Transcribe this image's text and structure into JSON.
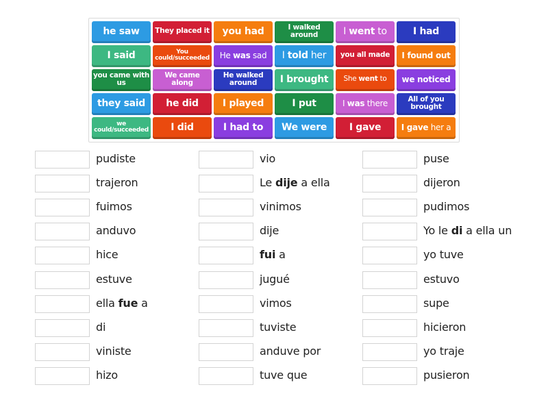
{
  "colors": {
    "blue": "#2d9be3",
    "red": "#d21f35",
    "orange": "#f57d0f",
    "darkgreen": "#1e8e46",
    "pink": "#c85fd2",
    "navy": "#2b3bbf",
    "green": "#3db882",
    "redorange": "#ea4a0e",
    "purple": "#8a3ee0"
  },
  "tiles": [
    [
      {
        "parts": [
          {
            "t": "he saw",
            "b": true
          }
        ],
        "color": "blue",
        "size": "l"
      },
      {
        "parts": [
          {
            "t": "They placed it",
            "b": true
          }
        ],
        "color": "red",
        "size": "s"
      },
      {
        "parts": [
          {
            "t": "you had",
            "b": true
          }
        ],
        "color": "orange",
        "size": "l"
      },
      {
        "parts": [
          {
            "t": "I walked around",
            "b": true
          }
        ],
        "color": "darkgreen",
        "size": "s"
      },
      {
        "parts": [
          {
            "t": "I ",
            "b": false
          },
          {
            "t": "went",
            "b": true
          },
          {
            "t": " to",
            "b": false
          }
        ],
        "color": "pink",
        "size": "l"
      },
      {
        "parts": [
          {
            "t": "I had",
            "b": true
          }
        ],
        "color": "navy",
        "size": "l"
      }
    ],
    [
      {
        "parts": [
          {
            "t": "I said",
            "b": true
          }
        ],
        "color": "green",
        "size": "l"
      },
      {
        "parts": [
          {
            "t": "You could/succeeded",
            "b": true
          }
        ],
        "color": "redorange",
        "size": "xs"
      },
      {
        "parts": [
          {
            "t": "He ",
            "b": false
          },
          {
            "t": "was",
            "b": true
          },
          {
            "t": " sad",
            "b": false
          }
        ],
        "color": "purple",
        "size": "m"
      },
      {
        "parts": [
          {
            "t": "I ",
            "b": false
          },
          {
            "t": "told",
            "b": true
          },
          {
            "t": " her",
            "b": false
          }
        ],
        "color": "blue",
        "size": "l"
      },
      {
        "parts": [
          {
            "t": "you all made",
            "b": true
          }
        ],
        "color": "red",
        "size": "s"
      },
      {
        "parts": [
          {
            "t": "I found out",
            "b": true
          }
        ],
        "color": "orange",
        "size": "m"
      }
    ],
    [
      {
        "parts": [
          {
            "t": "you came with us",
            "b": true
          }
        ],
        "color": "darkgreen",
        "size": "s"
      },
      {
        "parts": [
          {
            "t": "We came along",
            "b": true
          }
        ],
        "color": "pink",
        "size": "s"
      },
      {
        "parts": [
          {
            "t": "He walked around",
            "b": true
          }
        ],
        "color": "navy",
        "size": "s"
      },
      {
        "parts": [
          {
            "t": "I brought",
            "b": true
          }
        ],
        "color": "green",
        "size": "l"
      },
      {
        "parts": [
          {
            "t": "She ",
            "b": false
          },
          {
            "t": "went",
            "b": true
          },
          {
            "t": " to",
            "b": false
          }
        ],
        "color": "redorange",
        "size": "s"
      },
      {
        "parts": [
          {
            "t": "we noticed",
            "b": true
          }
        ],
        "color": "purple",
        "size": "m"
      }
    ],
    [
      {
        "parts": [
          {
            "t": "they said",
            "b": true
          }
        ],
        "color": "blue",
        "size": "l"
      },
      {
        "parts": [
          {
            "t": "he did",
            "b": true
          }
        ],
        "color": "red",
        "size": "l"
      },
      {
        "parts": [
          {
            "t": "I played",
            "b": true
          }
        ],
        "color": "orange",
        "size": "l"
      },
      {
        "parts": [
          {
            "t": "I put",
            "b": true
          }
        ],
        "color": "darkgreen",
        "size": "l"
      },
      {
        "parts": [
          {
            "t": "I ",
            "b": false
          },
          {
            "t": "was",
            "b": true
          },
          {
            "t": " there",
            "b": false
          }
        ],
        "color": "pink",
        "size": "m"
      },
      {
        "parts": [
          {
            "t": "All of you brought",
            "b": true
          }
        ],
        "color": "navy",
        "size": "s"
      }
    ],
    [
      {
        "parts": [
          {
            "t": "we could/succeeded",
            "b": true
          }
        ],
        "color": "green",
        "size": "xs"
      },
      {
        "parts": [
          {
            "t": "I did",
            "b": true
          }
        ],
        "color": "redorange",
        "size": "l"
      },
      {
        "parts": [
          {
            "t": "I had to",
            "b": true
          }
        ],
        "color": "purple",
        "size": "l"
      },
      {
        "parts": [
          {
            "t": "We were",
            "b": true
          }
        ],
        "color": "blue",
        "size": "l"
      },
      {
        "parts": [
          {
            "t": "I gave",
            "b": true
          }
        ],
        "color": "red",
        "size": "l"
      },
      {
        "parts": [
          {
            "t": "I ",
            "b": true
          },
          {
            "t": "gave",
            "b": true
          },
          {
            "t": " her a",
            "b": false
          }
        ],
        "color": "orange",
        "size": "m"
      }
    ]
  ],
  "columns": [
    [
      [
        {
          "t": "pudiste",
          "b": false
        }
      ],
      [
        {
          "t": "trajeron",
          "b": false
        }
      ],
      [
        {
          "t": "fuimos",
          "b": false
        }
      ],
      [
        {
          "t": "anduvo",
          "b": false
        }
      ],
      [
        {
          "t": "hice",
          "b": false
        }
      ],
      [
        {
          "t": "estuve",
          "b": false
        }
      ],
      [
        {
          "t": "ella ",
          "b": false
        },
        {
          "t": "fue",
          "b": true
        },
        {
          "t": " a",
          "b": false
        }
      ],
      [
        {
          "t": "di",
          "b": false
        }
      ],
      [
        {
          "t": "viniste",
          "b": false
        }
      ],
      [
        {
          "t": "hizo",
          "b": false
        }
      ]
    ],
    [
      [
        {
          "t": "vio",
          "b": false
        }
      ],
      [
        {
          "t": "Le ",
          "b": false
        },
        {
          "t": "dije",
          "b": true
        },
        {
          "t": " a ella",
          "b": false
        }
      ],
      [
        {
          "t": "vinimos",
          "b": false
        }
      ],
      [
        {
          "t": "dije",
          "b": false
        }
      ],
      [
        {
          "t": "fui",
          "b": true
        },
        {
          "t": " a",
          "b": false
        }
      ],
      [
        {
          "t": "jugué",
          "b": false
        }
      ],
      [
        {
          "t": "vimos",
          "b": false
        }
      ],
      [
        {
          "t": "tuviste",
          "b": false
        }
      ],
      [
        {
          "t": "anduve por",
          "b": false
        }
      ],
      [
        {
          "t": "tuve que",
          "b": false
        }
      ]
    ],
    [
      [
        {
          "t": "puse",
          "b": false
        }
      ],
      [
        {
          "t": "dijeron",
          "b": false
        }
      ],
      [
        {
          "t": "pudimos",
          "b": false
        }
      ],
      [
        {
          "t": "Yo le ",
          "b": false
        },
        {
          "t": "di",
          "b": true
        },
        {
          "t": " a ella un",
          "b": false
        }
      ],
      [
        {
          "t": "yo tuve",
          "b": false
        }
      ],
      [
        {
          "t": "estuvo",
          "b": false
        }
      ],
      [
        {
          "t": "supe",
          "b": false
        }
      ],
      [
        {
          "t": "hicieron",
          "b": false
        }
      ],
      [
        {
          "t": "yo traje",
          "b": false
        }
      ],
      [
        {
          "t": "pusieron",
          "b": false
        }
      ]
    ]
  ]
}
